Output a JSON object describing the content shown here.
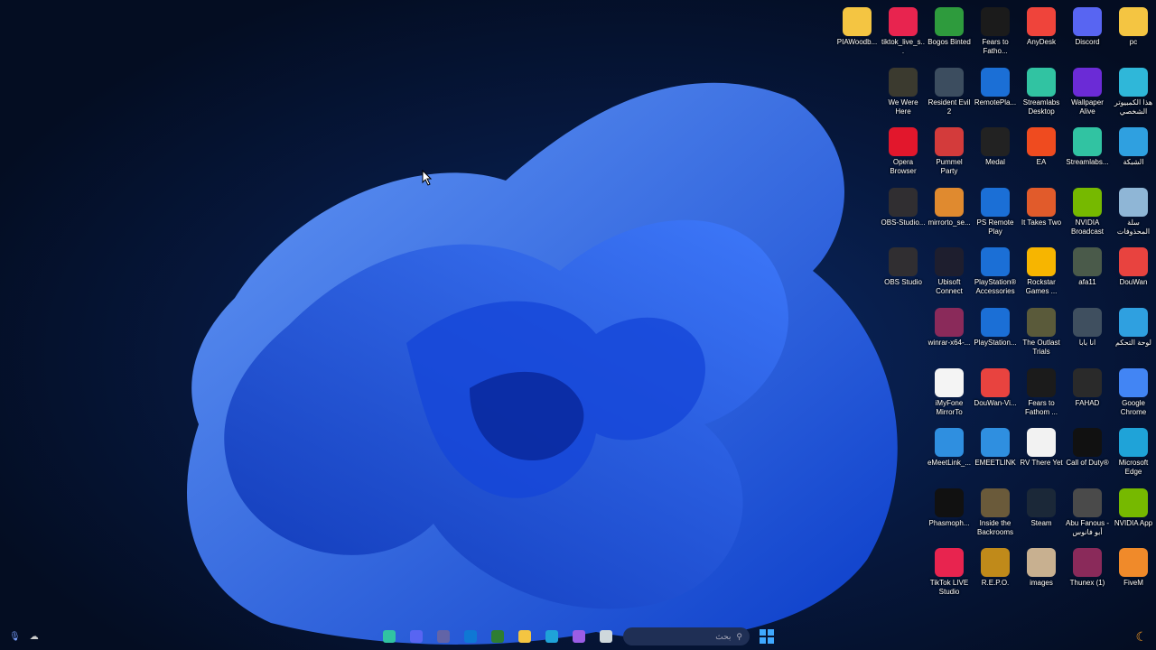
{
  "desktop": {
    "icons": [
      {
        "label": "PIAWoodb...",
        "icon": "folder-icon",
        "color": "#f4c542"
      },
      {
        "label": "tiktok_live_s...",
        "icon": "tiktok-icon",
        "color": "#e8244f"
      },
      {
        "label": "Bogos Binted",
        "icon": "alien-icon",
        "color": "#2e9b3d"
      },
      {
        "label": "Fears to Fatho...",
        "icon": "f2f-icon",
        "color": "#1b1b1b"
      },
      {
        "label": "AnyDesk",
        "icon": "anydesk-icon",
        "color": "#ef443b"
      },
      {
        "label": "Discord",
        "icon": "discord-icon",
        "color": "#5865f2"
      },
      {
        "label": "pc",
        "icon": "folder-icon",
        "color": "#f4c542"
      },
      {
        "label": "We Were Here",
        "icon": "game-icon",
        "color": "#3b3a2f"
      },
      {
        "label": "Resident Evil 2",
        "icon": "game-icon",
        "color": "#3c4d5f"
      },
      {
        "label": "RemotePla...",
        "icon": "remoteplay-icon",
        "color": "#1b6fd6"
      },
      {
        "label": "Streamlabs Desktop",
        "icon": "streamlabs-icon",
        "color": "#31c3a2"
      },
      {
        "label": "Wallpaper Alive",
        "icon": "wa-icon",
        "color": "#6b2bd6"
      },
      {
        "label": "هذا الكمبيوتر الشخصي",
        "icon": "monitor-icon",
        "color": "#2fb7d9"
      },
      {
        "label": "Opera Browser",
        "icon": "opera-icon",
        "color": "#e2172c"
      },
      {
        "label": "Pummel Party",
        "icon": "dice-icon",
        "color": "#d33b3b"
      },
      {
        "label": "Medal",
        "icon": "medal-icon",
        "color": "#222"
      },
      {
        "label": "EA",
        "icon": "ea-icon",
        "color": "#ef4b1f"
      },
      {
        "label": "Streamlabs...",
        "icon": "streamlabs-icon",
        "color": "#31c3a2"
      },
      {
        "label": "الشبكة",
        "icon": "network-icon",
        "color": "#2fa0e0"
      },
      {
        "label": "OBS-Studio...",
        "icon": "obs-icon",
        "color": "#302e31"
      },
      {
        "label": "mirrorto_se...",
        "icon": "puzzle-icon",
        "color": "#e08a2f"
      },
      {
        "label": "PS Remote Play",
        "icon": "remoteplay-icon",
        "color": "#1b6fd6"
      },
      {
        "label": "It Takes Two",
        "icon": "game-icon",
        "color": "#e15b2b"
      },
      {
        "label": "NVIDIA Broadcast",
        "icon": "nvidia-icon",
        "color": "#76b900"
      },
      {
        "label": "سلة المحذوفات",
        "icon": "recycle-bin-icon",
        "color": "#8fb6d6"
      },
      {
        "label": "OBS Studio",
        "icon": "obs-icon",
        "color": "#302e31"
      },
      {
        "label": "Ubisoft Connect",
        "icon": "ubisoft-icon",
        "color": "#1e1e2e"
      },
      {
        "label": "PlayStation® Accessories",
        "icon": "playstation-icon",
        "color": "#1b6fd6"
      },
      {
        "label": "Rockstar Games ...",
        "icon": "rockstar-icon",
        "color": "#f7b500"
      },
      {
        "label": "afa11",
        "icon": "image-icon",
        "color": "#4a5a4a"
      },
      {
        "label": "DouWan",
        "icon": "douwan-icon",
        "color": "#e8433f"
      },
      {
        "label": "winrar-x64-...",
        "icon": "winrar-icon",
        "color": "#8a2a5a"
      },
      {
        "label": "PlayStation...",
        "icon": "playstation-icon",
        "color": "#1b6fd6"
      },
      {
        "label": "The Outlast Trials",
        "icon": "game-icon",
        "color": "#5a5a3a"
      },
      {
        "label": "انا بابا",
        "icon": "image-icon",
        "color": "#3f4f5f"
      },
      {
        "label": "لوحة التحكم",
        "icon": "control-panel-icon",
        "color": "#2fa0e0"
      },
      {
        "label": "iMyFone MirrorTo",
        "icon": "imyfone-icon",
        "color": "#f4f4f4"
      },
      {
        "label": "DouWan-Vi...",
        "icon": "douwan-icon",
        "color": "#e8433f"
      },
      {
        "label": "Fears to Fathom ...",
        "icon": "f2f-icon",
        "color": "#1b1b1b"
      },
      {
        "label": "FAHAD",
        "icon": "image-icon",
        "color": "#2a2a2a"
      },
      {
        "label": "Google Chrome",
        "icon": "chrome-icon",
        "color": "#4285f4"
      },
      {
        "label": "eMeetLink_...",
        "icon": "emeet-icon",
        "color": "#2f8fe0"
      },
      {
        "label": "EMEETLINK",
        "icon": "emeet-icon",
        "color": "#2f8fe0"
      },
      {
        "label": "RV There Yet",
        "icon": "file-icon",
        "color": "#f2f2f2"
      },
      {
        "label": "Call of Duty®",
        "icon": "cod-icon",
        "color": "#111"
      },
      {
        "label": "Microsoft Edge",
        "icon": "edge-icon",
        "color": "#1fa3d8"
      },
      {
        "label": "Phasmoph...",
        "icon": "phasmo-icon",
        "color": "#111"
      },
      {
        "label": "Inside the Backrooms",
        "icon": "game-icon",
        "color": "#6a5a3a"
      },
      {
        "label": "Steam",
        "icon": "steam-icon",
        "color": "#1b2838"
      },
      {
        "label": "Abu Fanous - أبو فانوس",
        "icon": "game-icon",
        "color": "#4a4a4a"
      },
      {
        "label": "NVIDIA App",
        "icon": "nvidia-icon",
        "color": "#76b900"
      },
      {
        "label": "TikTok LIVE Studio",
        "icon": "tiktok-icon",
        "color": "#e8244f"
      },
      {
        "label": "R.E.P.O.",
        "icon": "repo-icon",
        "color": "#c08a1a"
      },
      {
        "label": "images",
        "icon": "image-icon",
        "color": "#c8b090"
      },
      {
        "label": "Thunex (1)",
        "icon": "winrar-icon",
        "color": "#8a2a5a"
      },
      {
        "label": "FiveM",
        "icon": "fivem-icon",
        "color": "#f08a2a"
      }
    ]
  },
  "taskbar": {
    "search_placeholder": "بحث",
    "apps": [
      {
        "icon": "streamlabs-icon",
        "color": "#31c3a2"
      },
      {
        "icon": "discord-icon",
        "color": "#5865f2"
      },
      {
        "icon": "teams-icon",
        "color": "#6264a7"
      },
      {
        "icon": "outlook-icon",
        "color": "#0f78d4"
      },
      {
        "icon": "store-icon",
        "color": "#2e7d32"
      },
      {
        "icon": "file-explorer-icon",
        "color": "#f4c542"
      },
      {
        "icon": "edge-icon",
        "color": "#1fa3d8"
      },
      {
        "icon": "copilot-icon",
        "color": "#9b5de5"
      },
      {
        "icon": "notepad-icon",
        "color": "#cfd8dc"
      }
    ]
  }
}
